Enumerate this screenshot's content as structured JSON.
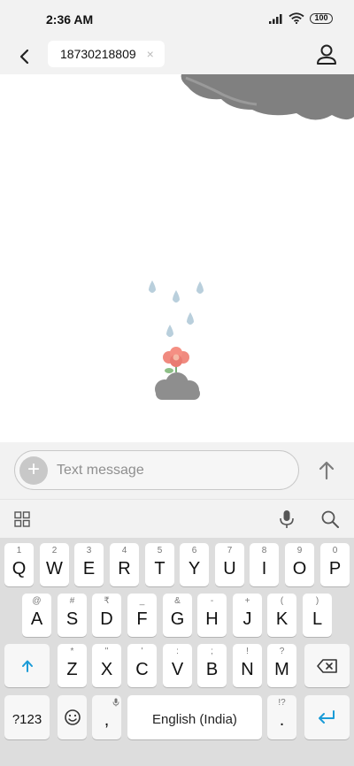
{
  "status_bar": {
    "time": "2:36 AM",
    "battery": "100"
  },
  "header": {
    "recipient": "18730218809",
    "clear_symbol": "×"
  },
  "compose": {
    "placeholder": "Text message",
    "add_symbol": "+"
  },
  "keyboard": {
    "row1": [
      {
        "hint": "1",
        "key": "Q"
      },
      {
        "hint": "2",
        "key": "W"
      },
      {
        "hint": "3",
        "key": "E"
      },
      {
        "hint": "4",
        "key": "R"
      },
      {
        "hint": "5",
        "key": "T"
      },
      {
        "hint": "6",
        "key": "Y"
      },
      {
        "hint": "7",
        "key": "U"
      },
      {
        "hint": "8",
        "key": "I"
      },
      {
        "hint": "9",
        "key": "O"
      },
      {
        "hint": "0",
        "key": "P"
      }
    ],
    "row2": [
      {
        "hint": "@",
        "key": "A"
      },
      {
        "hint": "#",
        "key": "S"
      },
      {
        "hint": "₹",
        "key": "D"
      },
      {
        "hint": "_",
        "key": "F"
      },
      {
        "hint": "&",
        "key": "G"
      },
      {
        "hint": "-",
        "key": "H"
      },
      {
        "hint": "+",
        "key": "J"
      },
      {
        "hint": "(",
        "key": "K"
      },
      {
        "hint": ")",
        "key": "L"
      }
    ],
    "row3": [
      {
        "hint": "*",
        "key": "Z"
      },
      {
        "hint": "\"",
        "key": "X"
      },
      {
        "hint": "'",
        "key": "C"
      },
      {
        "hint": ":",
        "key": "V"
      },
      {
        "hint": ";",
        "key": "B"
      },
      {
        "hint": "!",
        "key": "N"
      },
      {
        "hint": "?",
        "key": "M"
      }
    ],
    "symbols_label": "?123",
    "comma": ",",
    "space_label": "English (India)",
    "period": ".",
    "period_hint": "!?"
  },
  "colors": {
    "accent": "#1a9bd7",
    "background": "#f2f2f2",
    "keyboard_bg": "#dddddd",
    "key_bg": "#ffffff"
  }
}
